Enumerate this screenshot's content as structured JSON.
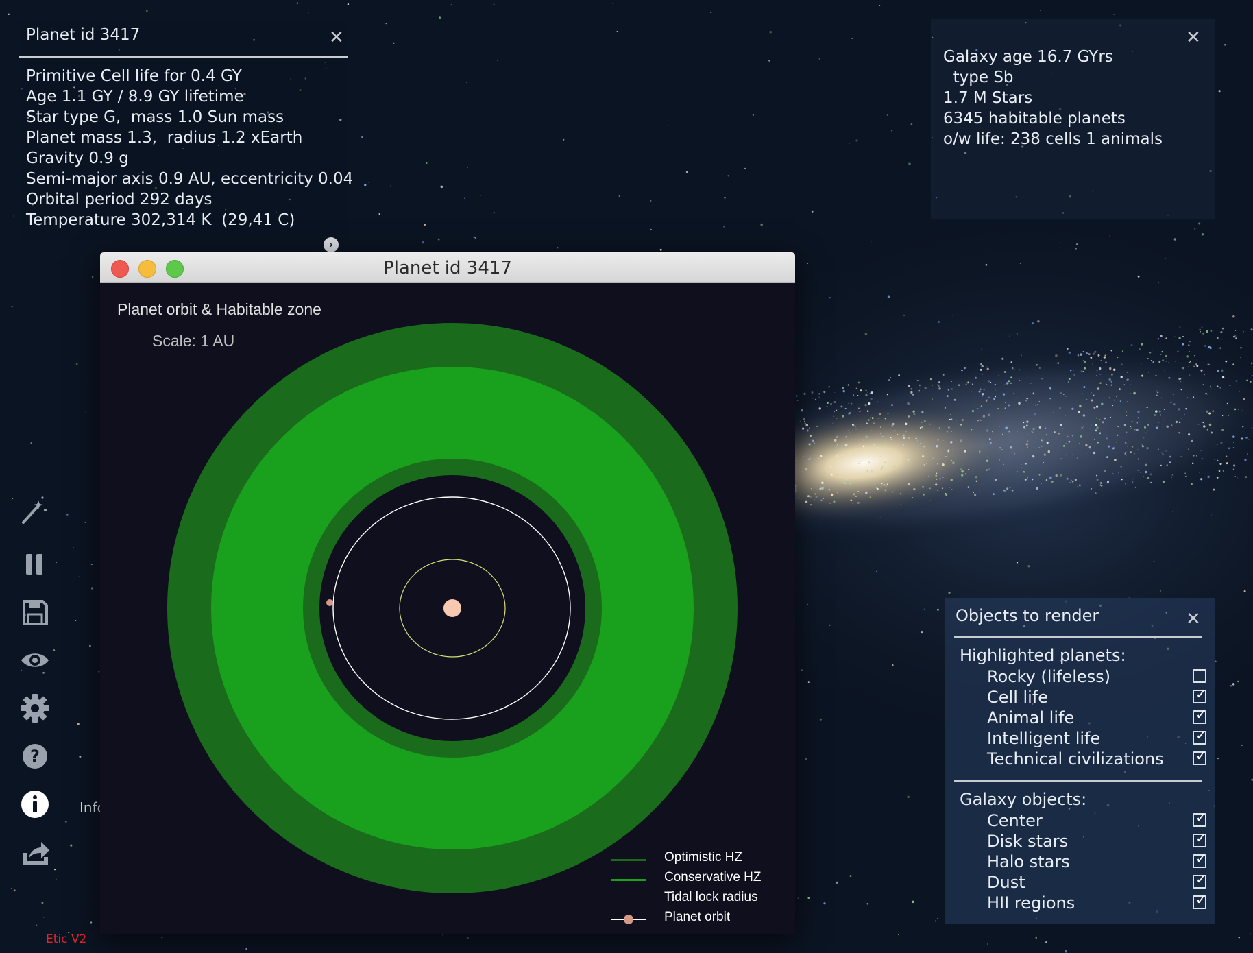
{
  "planet_panel": {
    "title": "Planet id 3417",
    "lines": [
      "Primitive Cell life for 0.4 GY",
      "Age 1.1 GY / 8.9 GY lifetime",
      "Star type G,  mass 1.0 Sun mass",
      "Planet mass 1.3,  radius 1.2 xEarth",
      "Gravity 0.9 g",
      "Semi-major axis 0.9 AU, eccentricity 0.04",
      "Orbital period 292 days",
      "Temperature 302,314 K  (29,41 C)"
    ],
    "close_icon": "close-icon",
    "expand_icon": "chevron-right-icon"
  },
  "galaxy_panel": {
    "lines": [
      "Galaxy age 16.7 GYrs",
      "  type Sb",
      "1.7 M Stars",
      "6345 habitable planets",
      "o/w life: 238 cells 1 animals"
    ]
  },
  "toolbar": {
    "items": [
      "magic-wand-icon",
      "pause-icon",
      "save-icon",
      "eye-icon",
      "gear-icon",
      "help-icon",
      "info-icon",
      "share-icon"
    ],
    "info_label": "Info"
  },
  "version": "Etic V2",
  "orbit_window": {
    "title": "Planet id 3417",
    "subtitle": "Planet orbit & Habitable zone",
    "scale": "Scale: 1 AU",
    "colors": {
      "optimistic": "#1b6b1d",
      "conservative": "#19a11d",
      "tidal": "#d8e27a",
      "orbit": "#ffffff",
      "star": "#f6c9b0",
      "planet": "#d49a86"
    },
    "legend": [
      {
        "label": "Optimistic HZ"
      },
      {
        "label": "Conservative HZ"
      },
      {
        "label": "Tidal lock radius"
      },
      {
        "label": "Planet orbit"
      }
    ]
  },
  "objects_panel": {
    "title": "Objects to render",
    "highlighted_label": "Highlighted planets:",
    "highlighted": [
      {
        "label": "Rocky (lifeless)",
        "checked": false
      },
      {
        "label": "Cell life",
        "checked": true
      },
      {
        "label": "Animal life",
        "checked": true
      },
      {
        "label": "Intelligent life",
        "checked": true
      },
      {
        "label": "Technical civilizations",
        "checked": true
      }
    ],
    "galaxy_label": "Galaxy objects:",
    "galaxy": [
      {
        "label": "Center",
        "checked": true
      },
      {
        "label": "Disk stars",
        "checked": true
      },
      {
        "label": "Halo stars",
        "checked": true
      },
      {
        "label": "Dust",
        "checked": true
      },
      {
        "label": "HII regions",
        "checked": true
      }
    ]
  }
}
